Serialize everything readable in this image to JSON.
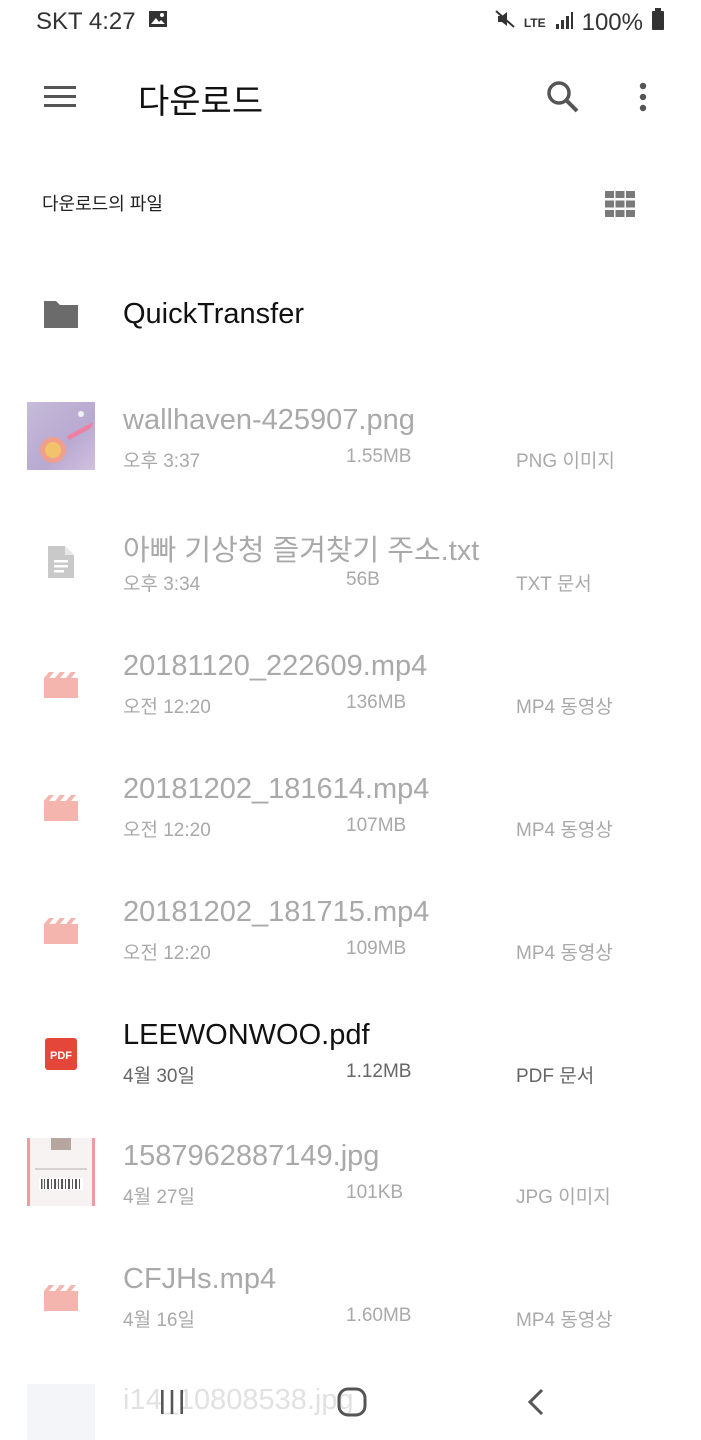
{
  "status_bar": {
    "carrier_time": "SKT 4:27",
    "network": "LTE",
    "battery": "100%",
    "icons": [
      "gallery-icon",
      "mute-icon",
      "lte-icon",
      "signal-icon",
      "battery-icon"
    ]
  },
  "app_bar": {
    "title": "다운로드",
    "icons": [
      "menu-icon",
      "search-icon",
      "more-vert-icon"
    ]
  },
  "section": {
    "title": "다운로드의 파일",
    "view_icon": "grid-view-icon"
  },
  "folder": {
    "name": "QuickTransfer",
    "icon": "folder-icon"
  },
  "files": [
    {
      "name": "wallhaven-425907.png",
      "date": "오후 3:37",
      "size": "1.55MB",
      "type": "PNG 이미지",
      "icon": "image-thumbnail",
      "dimmed": true
    },
    {
      "name": "아빠 기상청 즐겨찾기 주소.txt",
      "date": "오후 3:34",
      "size": "56B",
      "type": "TXT 문서",
      "icon": "document-icon",
      "dimmed": true
    },
    {
      "name": "20181120_222609.mp4",
      "date": "오전 12:20",
      "size": "136MB",
      "type": "MP4 동영상",
      "icon": "video-icon",
      "dimmed": true
    },
    {
      "name": "20181202_181614.mp4",
      "date": "오전 12:20",
      "size": "107MB",
      "type": "MP4 동영상",
      "icon": "video-icon",
      "dimmed": true
    },
    {
      "name": "20181202_181715.mp4",
      "date": "오전 12:20",
      "size": "109MB",
      "type": "MP4 동영상",
      "icon": "video-icon",
      "dimmed": true
    },
    {
      "name": "LEEWONWOO.pdf",
      "date": "4월 30일",
      "size": "1.12MB",
      "type": "PDF 문서",
      "icon": "pdf-icon",
      "pdf_label": "PDF",
      "dimmed": false
    },
    {
      "name": "1587962887149.jpg",
      "date": "4월 27일",
      "size": "101KB",
      "type": "JPG 이미지",
      "icon": "image-thumbnail",
      "dimmed": true
    },
    {
      "name": "CFJHs.mp4",
      "date": "4월 16일",
      "size": "1.60MB",
      "type": "MP4 동영상",
      "icon": "video-icon",
      "dimmed": true
    }
  ],
  "partial_row": {
    "name": "i14_10808538.jpg"
  },
  "colors": {
    "pdf_red": "#e5463a",
    "video_pink": "#f4b5ae",
    "icon_gray": "#6b6b6b",
    "dim_text": "#a9a9a9"
  },
  "nav": {
    "icons": [
      "recents-icon",
      "home-icon",
      "back-icon"
    ]
  }
}
